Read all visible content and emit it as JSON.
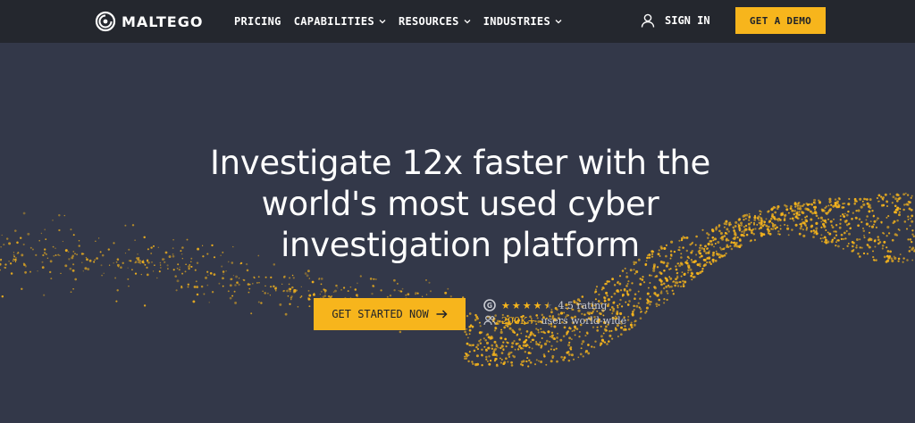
{
  "brand": {
    "name": "MALTEGO"
  },
  "nav": {
    "items": [
      {
        "label": "PRICING",
        "has_dropdown": false
      },
      {
        "label": "CAPABILITIES",
        "has_dropdown": true
      },
      {
        "label": "RESOURCES",
        "has_dropdown": true
      },
      {
        "label": "INDUSTRIES",
        "has_dropdown": true
      }
    ],
    "sign_in": "SIGN IN",
    "demo_button": "GET A DEMO"
  },
  "hero": {
    "headline": "Investigate 12x faster with the world's most used cyber investigation platform",
    "cta": "GET STARTED NOW",
    "rating": {
      "stars": 4.5,
      "text": "4.5 rating"
    },
    "users": {
      "count": "200K+",
      "text": "users world-wide"
    }
  },
  "colors": {
    "background": "#333849",
    "nav_background": "#24272e",
    "accent": "#f7b51c"
  }
}
